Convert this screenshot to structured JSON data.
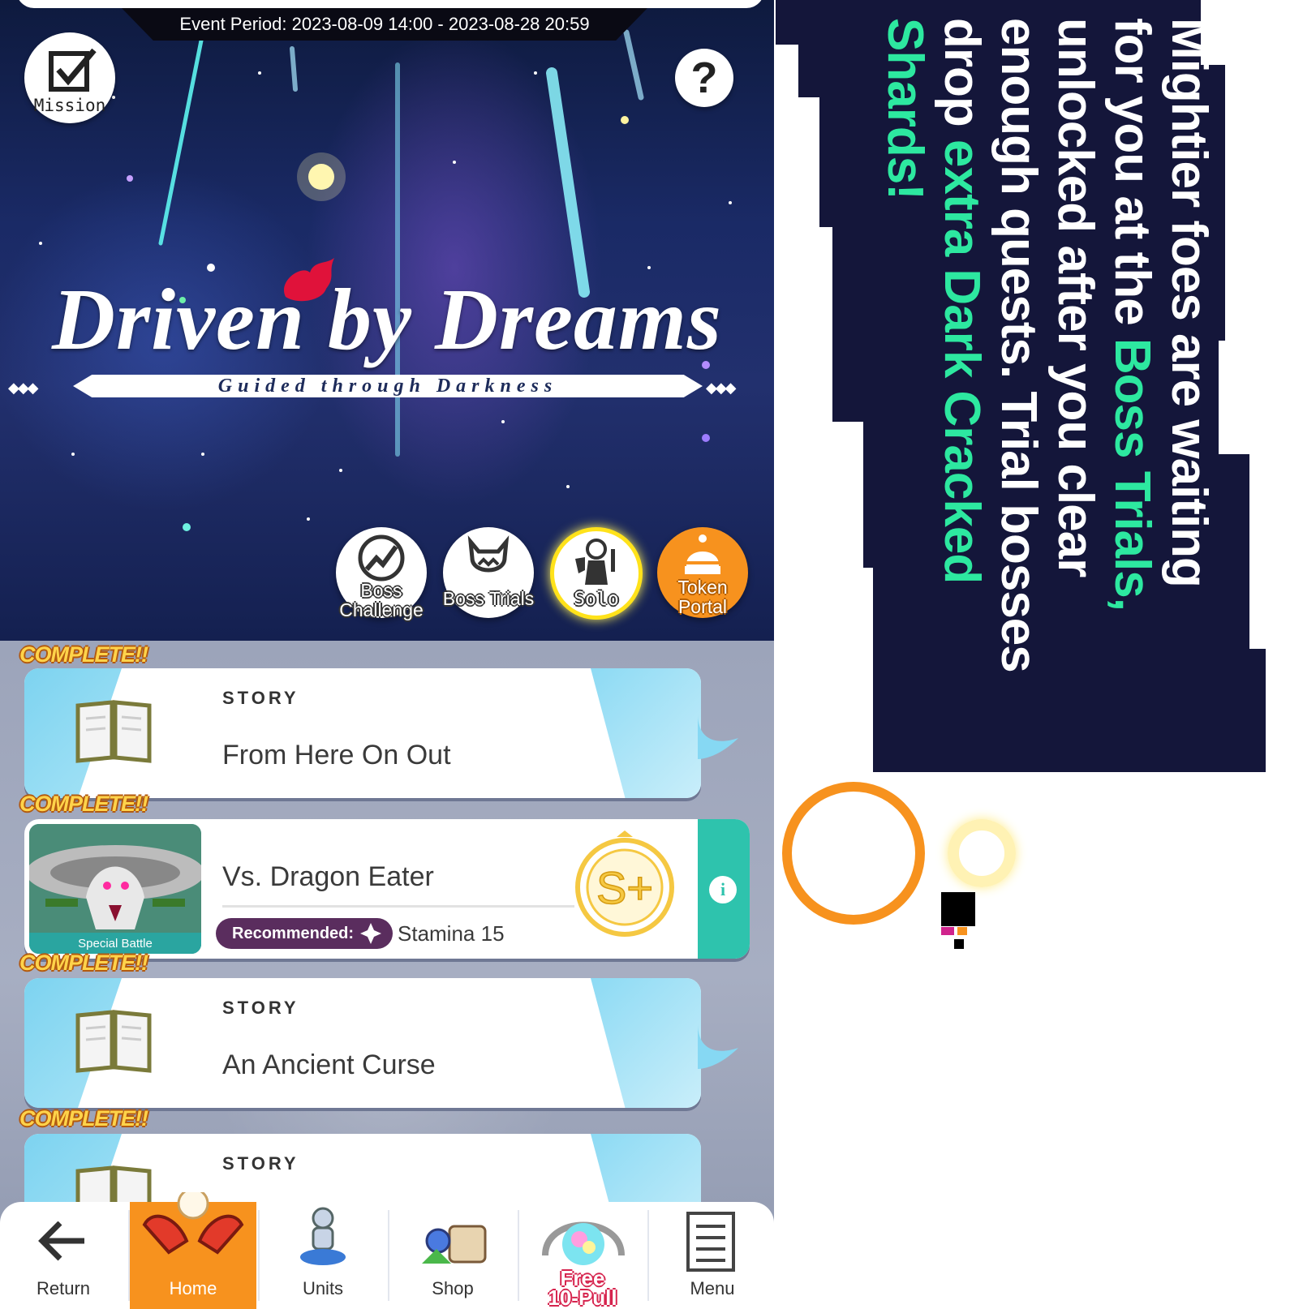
{
  "event": {
    "period": "Event Period: 2023-08-09 14:00 - 2023-08-28 20:59",
    "title": "Driven by Dreams",
    "subtitle": "Guided through Darkness"
  },
  "top_buttons": {
    "mission_label": "Mission",
    "help_glyph": "?"
  },
  "mode_buttons": [
    {
      "label": "Boss\nChallenge",
      "icon": "boss-challenge-icon"
    },
    {
      "label": "Boss Trials",
      "icon": "boss-trials-icon"
    },
    {
      "label": "Solo",
      "icon": "solo-icon",
      "selected": true
    },
    {
      "label": "Token\nPortal",
      "icon": "token-portal-icon"
    }
  ],
  "quests": [
    {
      "status": "COMPLETE!!",
      "type": "STORY",
      "title": "From Here On Out"
    },
    {
      "status": "COMPLETE!!",
      "type": "Special Battle",
      "title": "Vs. Dragon Eater",
      "recommended": "Recommended:",
      "stamina": "Stamina 15",
      "rank": "S+"
    },
    {
      "status": "COMPLETE!!",
      "type": "STORY",
      "title": "An Ancient Curse"
    },
    {
      "status": "COMPLETE!!",
      "type": "STORY",
      "title": ""
    }
  ],
  "nav": {
    "return": "Return",
    "home": "Home",
    "units": "Units",
    "shop": "Shop",
    "free_pull": "Free\n10-Pull",
    "menu": "Menu"
  },
  "promo": {
    "line1": "Mightier foes are waiting",
    "line2_pre": "for you at the ",
    "line2_hl": "Boss Trials,",
    "line3": "unlocked after you clear",
    "line4": "enough quests. Trial bosses",
    "line5_pre": "drop ",
    "line5_hl": "extra Dark Cracked Shards!",
    "text_color": "#ffffff",
    "highlight_color": "#2de8a0",
    "background": "#14163a"
  },
  "colors": {
    "accent_orange": "#f7921e",
    "teal": "#2ec3ad",
    "complete_gold": "#ffd34a"
  }
}
